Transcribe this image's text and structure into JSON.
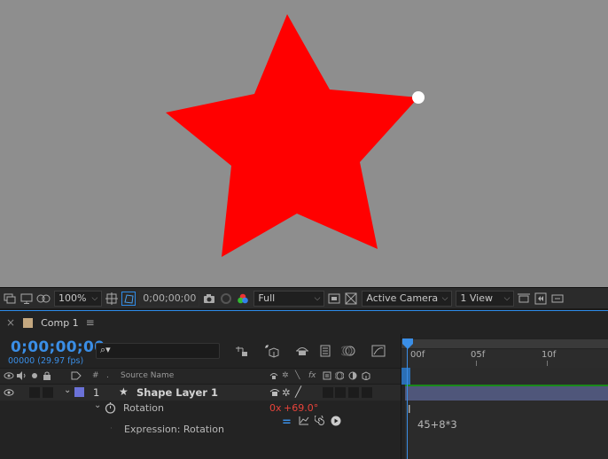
{
  "viewer": {
    "background": "#8e8e8e",
    "shape_color": "#ff0000",
    "handle_color": "#ffffff"
  },
  "viewer_toolbar": {
    "zoom": "100%",
    "timecode": "0;00;00;00",
    "resolution": "Full",
    "camera": "Active Camera",
    "views": "1 View"
  },
  "timeline": {
    "tab_close": "×",
    "tab_title": "Comp 1",
    "tab_menu": "≡",
    "timecode": "0;00;00;00",
    "fps_label": "00000 (29.97 fps)",
    "search_placeholder": "⌕▾",
    "columns": {
      "number": "#",
      "source_name": "Source Name"
    },
    "layer": {
      "index": "1",
      "name": "Shape Layer 1",
      "label_color": "#6b72d8"
    },
    "rotation": {
      "label": "Rotation",
      "turns": "0x",
      "degrees": "+69.0°"
    },
    "expression_label": "Expression: Rotation",
    "ruler_labels": [
      "00f",
      "05f",
      "10f"
    ],
    "expression_text": "45+8*3",
    "colors": {
      "accent": "#3a8ee6",
      "value_red": "#e8433a",
      "layer_bar": "#4f567a"
    }
  }
}
